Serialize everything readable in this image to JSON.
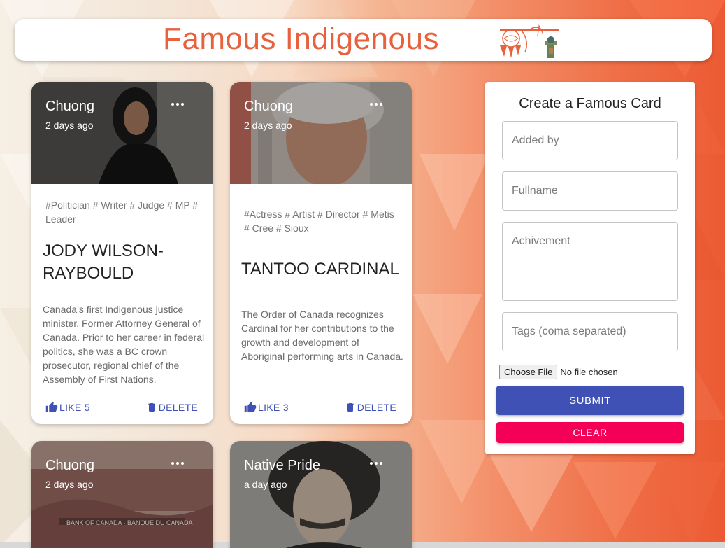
{
  "header": {
    "title": "Famous Indigenous"
  },
  "cards": [
    {
      "author": "Chuong",
      "time": "2 days ago",
      "tags": "#Politician # Writer # Judge # MP # Leader",
      "name": "JODY WILSON-RAYBOULD",
      "description": "Canada’s first Indigenous justice minister. Former Attorney General of Canada. Prior to her career in federal politics, she was a BC crown prosecutor, regional chief of the Assembly of First Nations.",
      "like_label": "LIKE 5",
      "delete_label": "DELETE"
    },
    {
      "author": "Chuong",
      "time": "2 days ago",
      "tags": "#Actress # Artist # Director # Metis # Cree # Sioux",
      "name": "TANTOO CARDINAL",
      "description": "The Order of Canada recognizes Cardinal for her contributions to the growth and development of Aboriginal performing arts in Canada.",
      "like_label": "LIKE 3",
      "delete_label": "DELETE"
    },
    {
      "author": "Chuong",
      "time": "2 days ago"
    },
    {
      "author": "Native Pride",
      "time": "a day ago"
    }
  ],
  "form": {
    "title": "Create a Famous Card",
    "added_by_placeholder": "Added by",
    "fullname_placeholder": "Fullname",
    "achievement_placeholder": "Achivement",
    "tags_placeholder": "Tags (coma separated)",
    "choose_file_label": "Choose File",
    "no_file_label": "No file chosen",
    "submit_label": "SUBMIT",
    "clear_label": "CLEAR"
  },
  "colors": {
    "title": "#e8603c",
    "primary": "#3f51b5",
    "secondary": "#f50057"
  },
  "icons": [
    "more-horiz-icon",
    "thumb-up-icon",
    "trash-icon",
    "dreamcatcher-icon",
    "totem-icon"
  ]
}
